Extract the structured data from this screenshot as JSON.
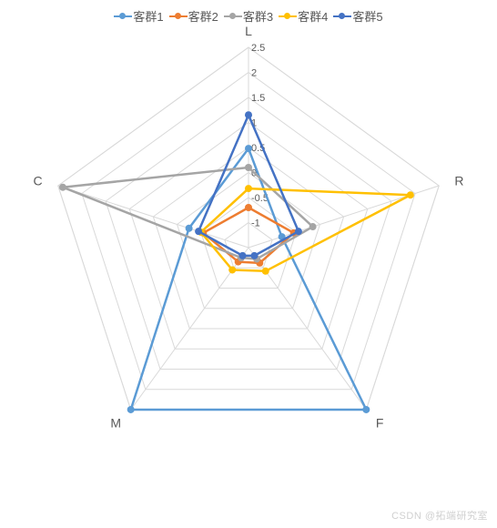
{
  "chart_data": {
    "type": "radar",
    "axes": [
      "L",
      "R",
      "F",
      "M",
      "C"
    ],
    "ticks": [
      -1,
      -0.5,
      0,
      0.5,
      1,
      1.5,
      2,
      2.5
    ],
    "rmin": -1.5,
    "rmax": 2.5,
    "series": [
      {
        "name": "客群1",
        "color": "#5B9BD5",
        "values": [
          0.48,
          -0.8,
          2.5,
          2.5,
          -0.25
        ]
      },
      {
        "name": "客群2",
        "color": "#ED7D31",
        "values": [
          -0.7,
          -0.55,
          -1.12,
          -1.15,
          -0.55
        ]
      },
      {
        "name": "客群3",
        "color": "#A5A5A5",
        "values": [
          0.1,
          -0.15,
          -1.22,
          -1.25,
          2.4
        ]
      },
      {
        "name": "客群4",
        "color": "#FFC000",
        "values": [
          -0.32,
          1.9,
          -0.92,
          -0.95,
          -0.5
        ]
      },
      {
        "name": "客群5",
        "color": "#4472C4",
        "values": [
          1.15,
          -0.45,
          -1.3,
          -1.3,
          -0.45
        ]
      }
    ],
    "legend_position": "top"
  },
  "watermark": "CSDN @拓端研究室"
}
